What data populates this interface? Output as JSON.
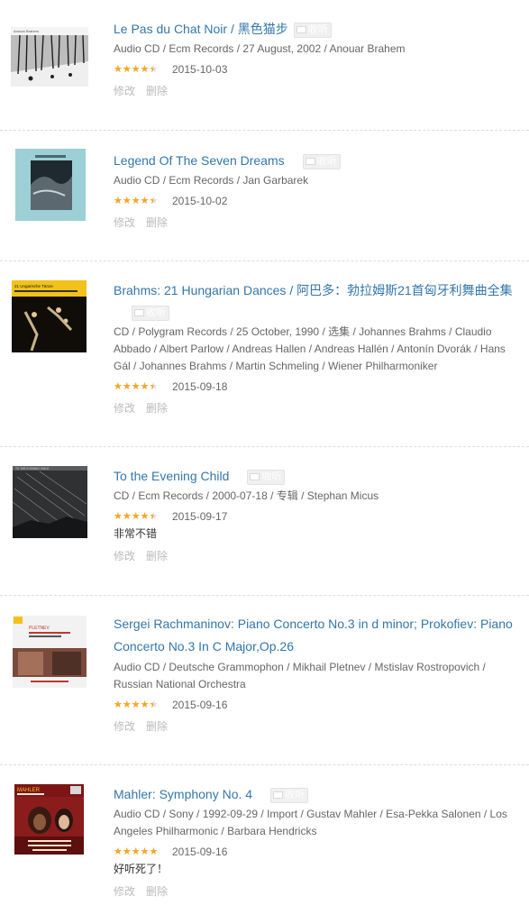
{
  "items": [
    {
      "title": "Le Pas du Chat Noir / 黑色猫步",
      "meta": "Audio CD / Ecm Records / 27 August, 2002 / Anouar Brahem",
      "rating": 4,
      "date": "2015-10-03",
      "comment": "",
      "cover_text": "Anouar Brahem"
    },
    {
      "title": "Legend Of The Seven Dreams",
      "meta": "Audio CD / Ecm Records / Jan Garbarek",
      "rating": 4,
      "date": "2015-10-02",
      "comment": "",
      "cover_text": ""
    },
    {
      "title": "Brahms: 21 Hungarian Dances / 阿巴多：勃拉姆斯21首匈牙利舞曲全集",
      "meta": "CD / Polygram Records / 25 October, 1990 / 选集 / Johannes Brahms / Claudio Abbado / Albert Parlow / Andreas Hallen / Andreas Hallén / Antonín Dvorák / Hans Gál / Johannes Brahms / Martin Schmeling / Wiener Philharmoniker",
      "rating": 4,
      "date": "2015-09-18",
      "comment": "",
      "cover_text": "21 Ungarische Tänze"
    },
    {
      "title": "To the Evening Child",
      "meta": "CD / Ecm Records / 2000-07-18 / 专辑 / Stephan Micus",
      "rating": 4,
      "date": "2015-09-17",
      "comment": "非常不错",
      "cover_text": "TO THE EVENING CHILD"
    },
    {
      "title": "Sergei Rachmaninov: Piano Concerto No.3 in d minor; Prokofiev: Piano Concerto No.3 In C Major,Op.26",
      "meta": "Audio CD / Deutsche Grammophon / Mikhail Pletnev / Mstislav Rostropovich / Russian National Orchestra",
      "rating": 4,
      "date": "2015-09-16",
      "comment": "",
      "cover_text": "PLETNEV"
    },
    {
      "title": "Mahler: Symphony No. 4",
      "meta": "Audio CD / Sony / 1992-09-29 / Import / Gustav Mahler / Esa-Pekka Salonen / Los Angeles Philharmonic / Barbara Hendricks",
      "rating": 5,
      "date": "2015-09-16",
      "comment": "好听死了！",
      "cover_text": "MAHLER"
    }
  ],
  "labels": {
    "listen": "收听",
    "edit": "修改",
    "delete": "删除"
  },
  "colors": {
    "link": "#3377aa",
    "star": "#f5a623",
    "star_empty": "#dcdcdc",
    "meta": "#666666",
    "action": "#bbbbbb"
  }
}
